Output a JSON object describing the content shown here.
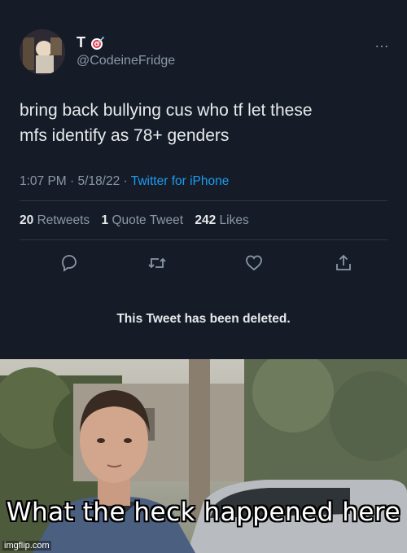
{
  "tweet": {
    "display_name": "T",
    "handle": "@CodeineFridge",
    "more_glyph": "…",
    "text_line1": "bring back bullying cus who tf let these",
    "text_line2": "mfs identify as 78+ genders",
    "time": "1:07 PM",
    "date": "5/18/22",
    "source": "Twitter for iPhone",
    "retweets_count": "20",
    "retweets_label": "Retweets",
    "quotes_count": "1",
    "quotes_label": "Quote Tweet",
    "likes_count": "242",
    "likes_label": "Likes",
    "deleted_notice": "This Tweet has been deleted.",
    "colors": {
      "background": "#151c28",
      "link": "#1d9bf0",
      "muted": "#8b98a5"
    }
  },
  "meme": {
    "caption": "What the heck happened here",
    "watermark": "imgflip.com"
  }
}
